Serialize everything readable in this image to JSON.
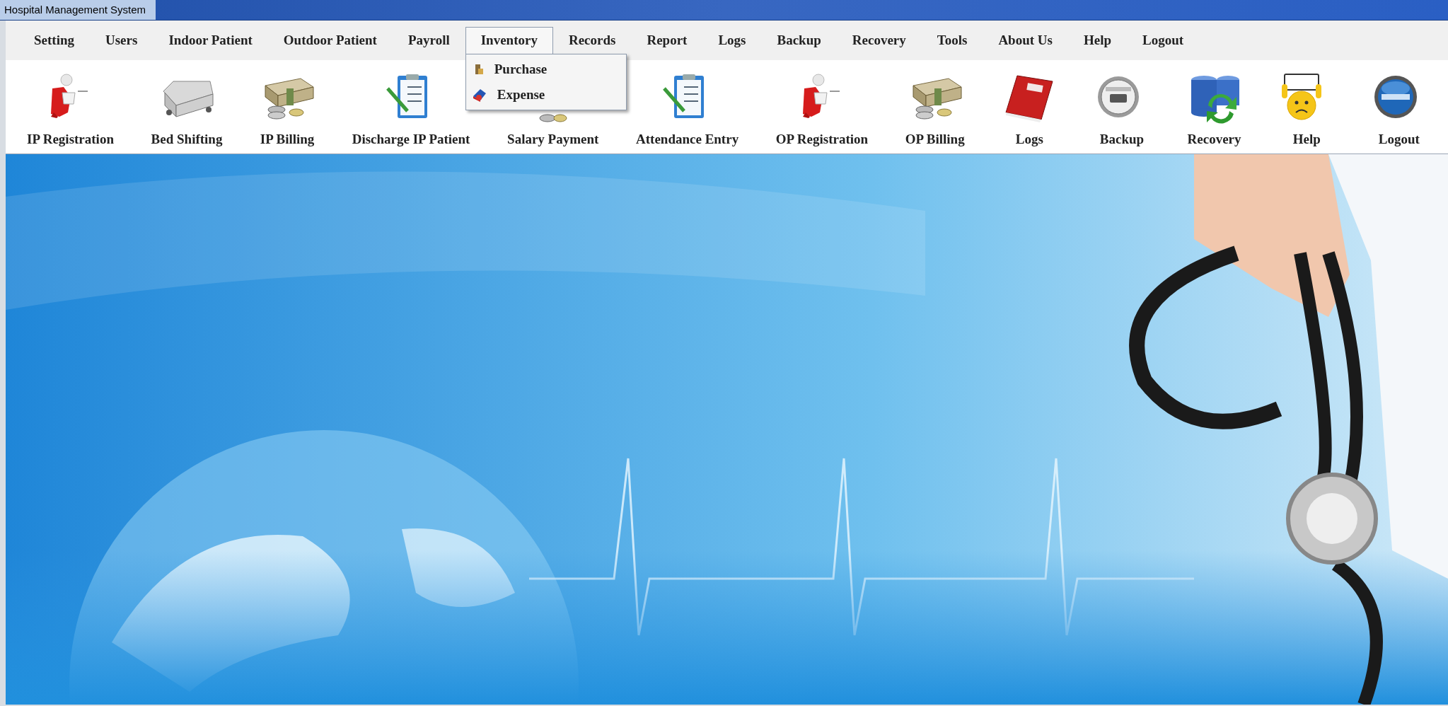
{
  "window": {
    "title": "Hospital Management System"
  },
  "menu": [
    {
      "label": "Setting",
      "selected": false
    },
    {
      "label": "Users",
      "selected": false
    },
    {
      "label": "Indoor Patient",
      "selected": false
    },
    {
      "label": "Outdoor Patient",
      "selected": false
    },
    {
      "label": "Payroll",
      "selected": false
    },
    {
      "label": "Inventory",
      "selected": true,
      "items": [
        {
          "label": "Purchase",
          "kind": "purchase"
        },
        {
          "label": "Expense",
          "kind": "expense"
        }
      ]
    },
    {
      "label": "Records",
      "selected": false
    },
    {
      "label": "Report",
      "selected": false
    },
    {
      "label": "Logs",
      "selected": false
    },
    {
      "label": "Backup",
      "selected": false
    },
    {
      "label": "Recovery",
      "selected": false
    },
    {
      "label": "Tools",
      "selected": false
    },
    {
      "label": "About Us",
      "selected": false
    },
    {
      "label": "Help",
      "selected": false
    },
    {
      "label": "Logout",
      "selected": false
    }
  ],
  "toolbar": [
    {
      "label": "IP Registration",
      "kind": "figure"
    },
    {
      "label": "Bed Shifting",
      "kind": "bed"
    },
    {
      "label": "IP Billing",
      "kind": "money"
    },
    {
      "label": "Discharge IP Patient",
      "kind": "clipboard"
    },
    {
      "label": "Salary Payment",
      "kind": "coins"
    },
    {
      "label": "Attendance Entry",
      "kind": "clipboard"
    },
    {
      "label": "OP Registration",
      "kind": "figure"
    },
    {
      "label": "OP Billing",
      "kind": "money"
    },
    {
      "label": "Logs",
      "kind": "book"
    },
    {
      "label": "Backup",
      "kind": "disc"
    },
    {
      "label": "Recovery",
      "kind": "database"
    },
    {
      "label": "Help",
      "kind": "help"
    },
    {
      "label": "Logout",
      "kind": "power"
    }
  ]
}
